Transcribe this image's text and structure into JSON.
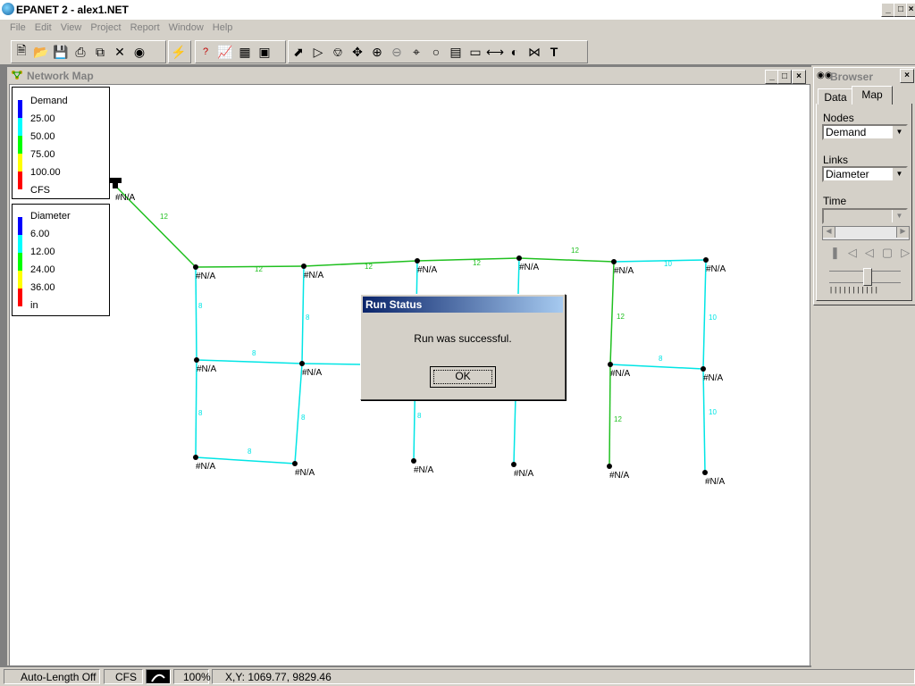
{
  "app": {
    "title": "EPANET 2 - alex1.NET"
  },
  "menu": [
    "File",
    "Edit",
    "View",
    "Project",
    "Report",
    "Window",
    "Help"
  ],
  "network_window": {
    "title": "Network Map"
  },
  "node_legend": {
    "title": "Demand",
    "labels": [
      "25.00",
      "50.00",
      "75.00",
      "100.00"
    ],
    "unit": "CFS"
  },
  "link_legend": {
    "title": "Diameter",
    "labels": [
      "6.00",
      "12.00",
      "24.00",
      "36.00"
    ],
    "unit": "in"
  },
  "legend_colors": [
    "#0000ff",
    "#00ffff",
    "#00ff00",
    "#ffff00",
    "#ff0000"
  ],
  "node_label": "#N/A",
  "link_colors": {
    "cyan": "#00e5e5",
    "green": "#20c020"
  },
  "link_labels": {
    "res_link": "12",
    "top1": "12",
    "top2": "12",
    "top3": "12",
    "top4": "12",
    "top5": "10",
    "c1": "8",
    "c1b": "8",
    "c2": "8",
    "c2b": "8",
    "mid1": "8",
    "bot1": "8",
    "c5": "12",
    "c5b": "12",
    "mid5": "8",
    "c6": "10",
    "c6b": "10",
    "c3b": "8"
  },
  "browser": {
    "title": "Browser",
    "tabs": [
      "Data",
      "Map"
    ],
    "nodes_label": "Nodes",
    "nodes_value": "Demand",
    "links_label": "Links",
    "links_value": "Diameter",
    "time_label": "Time",
    "time_value": ""
  },
  "dialog": {
    "title": "Run Status",
    "message": "Run was successful.",
    "ok": "OK"
  },
  "status": {
    "auto_length": "Auto-Length Off",
    "units": "CFS",
    "zoom": "100%",
    "xy": "X,Y: 1069.77, 9829.46"
  }
}
